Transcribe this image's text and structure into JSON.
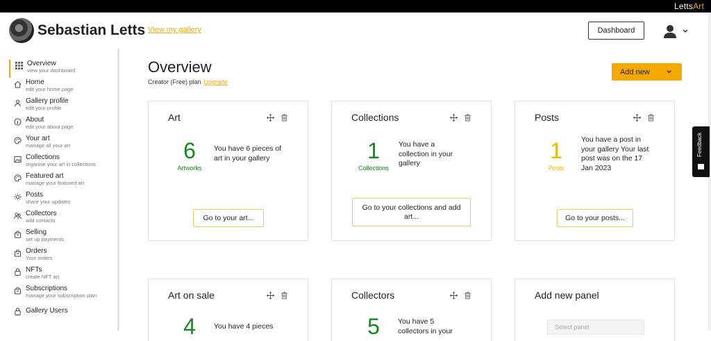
{
  "brand": {
    "name_part1": "Letts",
    "name_part2": "Art"
  },
  "header": {
    "user_name": "Sebastian Letts",
    "view_gallery_link": "View my gallery",
    "dashboard_button": "Dashboard"
  },
  "sidebar": {
    "items": [
      {
        "label": "Overview",
        "sub": "view your dashboard",
        "icon": "grid-icon",
        "active": true
      },
      {
        "label": "Home",
        "sub": "edit your home page",
        "icon": "home-icon"
      },
      {
        "label": "Gallery profile",
        "sub": "edit your profile",
        "icon": "person-icon"
      },
      {
        "label": "About",
        "sub": "edit your about page",
        "icon": "info-icon"
      },
      {
        "label": "Your art",
        "sub": "manage all your art",
        "icon": "palette-icon"
      },
      {
        "label": "Collections",
        "sub": "organise your art in collections",
        "icon": "image-icon"
      },
      {
        "label": "Featured art",
        "sub": "manage your featured art",
        "icon": "palette-icon"
      },
      {
        "label": "Posts",
        "sub": "share your updates",
        "icon": "bulb-icon"
      },
      {
        "label": "Collectors",
        "sub": "add contacts",
        "icon": "people-icon"
      },
      {
        "label": "Selling",
        "sub": "set up payments",
        "icon": "bag-icon"
      },
      {
        "label": "Orders",
        "sub": "Your orders",
        "icon": "bag-icon"
      },
      {
        "label": "NFTs",
        "sub": "create NFT art",
        "icon": "lock-icon"
      },
      {
        "label": "Subscriptions",
        "sub": "manage your subscription plan",
        "icon": "bag-icon"
      },
      {
        "label": "Gallery Users",
        "sub": "",
        "icon": "lock-icon"
      }
    ]
  },
  "main": {
    "title": "Overview",
    "plan_text": "Creator (Free) plan",
    "upgrade_link": "Upgrade",
    "add_new_button": "Add new"
  },
  "cards": {
    "art": {
      "title": "Art",
      "number": "6",
      "number_label": "Artworks",
      "desc": "You have 6 pieces of art in your gallery",
      "button": "Go to your art..."
    },
    "collections": {
      "title": "Collections",
      "number": "1",
      "number_label": "Collections",
      "desc": "You have a collection in your gallery",
      "button": "Go to your collections and add art..."
    },
    "posts": {
      "title": "Posts",
      "number": "1",
      "number_label": "Posts",
      "desc": "You have a post in your gallery Your last post was on the 17 Jan 2023",
      "button": "Go to your posts..."
    },
    "art_on_sale": {
      "title": "Art on sale",
      "number": "4",
      "desc": "You have 4 pieces"
    },
    "collectors": {
      "title": "Collectors",
      "number": "5",
      "desc": "You have 5 collectors in your"
    },
    "add_panel": {
      "title": "Add new panel",
      "select_placeholder": "Select panel"
    }
  },
  "feedback": {
    "label": "Feedback"
  },
  "colors": {
    "accent": "#f5a800",
    "green": "#138a1e",
    "gold": "#f5b400"
  }
}
